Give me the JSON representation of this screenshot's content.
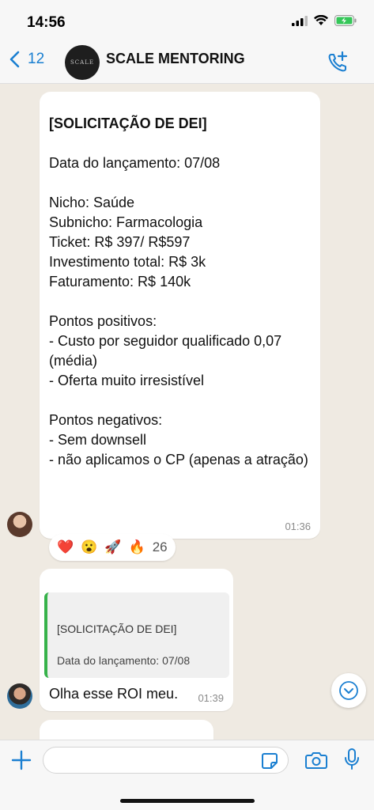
{
  "status_bar": {
    "time": "14:56"
  },
  "header": {
    "back_count": "12",
    "avatar_logo_text": "SCALE",
    "title": "SCALE MENTORING",
    "back_icon": "chevron-left-icon",
    "action_icon": "phone-add-icon"
  },
  "messages": [
    {
      "title": "[SOLICITAÇÃO DE DEI]",
      "body": "Data do lançamento: 07/08\n\nNicho: Saúde\nSubnicho: Farmacologia\nTicket: R$ 397/ R$597\nInvestimento total: R$ 3k\nFaturamento: R$ 140k\n\nPontos positivos:\n- Custo por seguidor qualificado 0,07 (média)\n- Oferta muito irresistível\n\nPontos negativos:\n- Sem downsell\n- não aplicamos o CP (apenas a atração)",
      "time": "01:36",
      "reactions": {
        "emojis": [
          "❤️",
          "😮",
          "🚀",
          "🔥"
        ],
        "count": "26"
      }
    },
    {
      "quote_title": "[SOLICITAÇÃO DE DEI]",
      "quote_sub": "Data do lançamento: 07/08",
      "text": "Olha esse ROI meu.",
      "time": "01:39"
    }
  ],
  "input": {
    "placeholder": ""
  },
  "colors": {
    "accent": "#1a7fd1",
    "quote_bar": "#36b24a",
    "chat_bg": "#efeae2"
  }
}
